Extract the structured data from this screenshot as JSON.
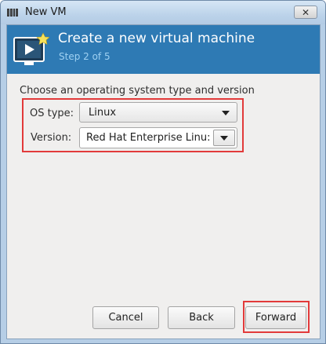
{
  "window": {
    "title": "New VM",
    "close_glyph": "✕"
  },
  "banner": {
    "title": "Create a new virtual machine",
    "step": "Step 2 of 5",
    "icon": "virtual-machine-icon"
  },
  "form": {
    "section_label": "Choose an operating system type and version",
    "os_type": {
      "label": "OS type:",
      "value": "Linux"
    },
    "version": {
      "label": "Version:",
      "value": "Red Hat Enterprise Linu:"
    }
  },
  "buttons": {
    "cancel": "Cancel",
    "back": "Back",
    "forward": "Forward"
  },
  "colors": {
    "banner": "#2e7ab4",
    "highlight": "#e23a3a",
    "step_text": "#9fd1f2"
  }
}
